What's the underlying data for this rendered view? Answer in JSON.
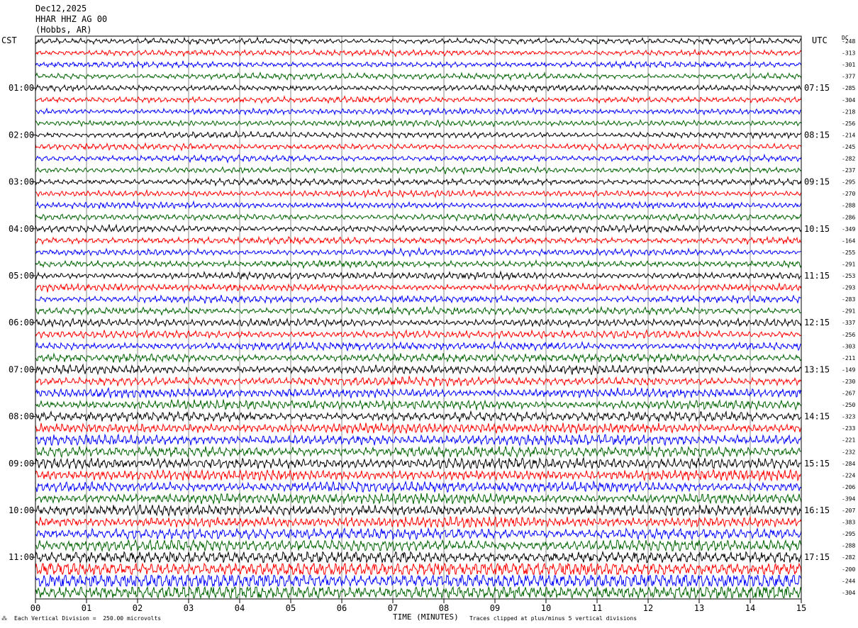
{
  "header": {
    "date": "Dec12,2025",
    "station": "HHAR HHZ AG 00",
    "location": "(Hobbs, AR)"
  },
  "left_tz": "CST",
  "right_tz": "UTC",
  "dc_label": "DC",
  "footer": {
    "scale_note": "Each Vertical Division =  250.00 microvolts",
    "clip_note": "Traces clipped at plus/minus 5 vertical divisions",
    "xlabel": "TIME (MINUTES)"
  },
  "chart_data": {
    "type": "line",
    "title": "",
    "xlabel": "TIME (MINUTES)",
    "ylabel": "",
    "xlim": [
      0,
      15
    ],
    "x_ticks": [
      "00",
      "01",
      "02",
      "03",
      "04",
      "05",
      "06",
      "07",
      "08",
      "09",
      "10",
      "11",
      "12",
      "13",
      "14",
      "15"
    ],
    "grid": true,
    "trace_colors": [
      "#000000",
      "#ff0000",
      "#0000ff",
      "#006400"
    ],
    "left_hour_labels": [
      "01:00",
      "02:00",
      "03:00",
      "04:00",
      "05:00",
      "06:00",
      "07:00",
      "08:00",
      "09:00",
      "10:00",
      "11:00"
    ],
    "right_hour_labels": [
      "07:15",
      "08:15",
      "09:15",
      "10:15",
      "11:15",
      "12:15",
      "13:15",
      "14:15",
      "15:15",
      "16:15",
      "17:15"
    ],
    "trace_count": 48,
    "dc_offsets": [
      -248,
      -313,
      -301,
      -377,
      -285,
      -304,
      -218,
      -256,
      -214,
      -245,
      -282,
      -237,
      -295,
      -270,
      -288,
      -286,
      -349,
      -164,
      -255,
      -291,
      -253,
      -293,
      -283,
      -291,
      -337,
      -256,
      -303,
      -211,
      -149,
      -230,
      -267,
      -250,
      -323,
      -233,
      -221,
      -232,
      -284,
      -224,
      -206,
      -394,
      -207,
      -383,
      -295,
      -288,
      -282,
      -200,
      -244,
      -304
    ],
    "trace_amplitude_level": [
      1.0,
      1.0,
      1.0,
      1.05,
      1.05,
      1.05,
      1.05,
      1.05,
      1.05,
      1.05,
      1.05,
      1.05,
      1.1,
      1.1,
      1.1,
      1.1,
      1.15,
      1.15,
      1.15,
      1.2,
      1.2,
      1.25,
      1.25,
      1.3,
      1.3,
      1.35,
      1.4,
      1.45,
      1.5,
      1.55,
      1.6,
      1.65,
      1.7,
      1.8,
      1.9,
      1.9,
      2.0,
      1.9,
      1.9,
      1.9,
      1.9,
      1.9,
      2.0,
      2.1,
      2.2,
      2.8,
      3.1,
      2.6
    ]
  }
}
